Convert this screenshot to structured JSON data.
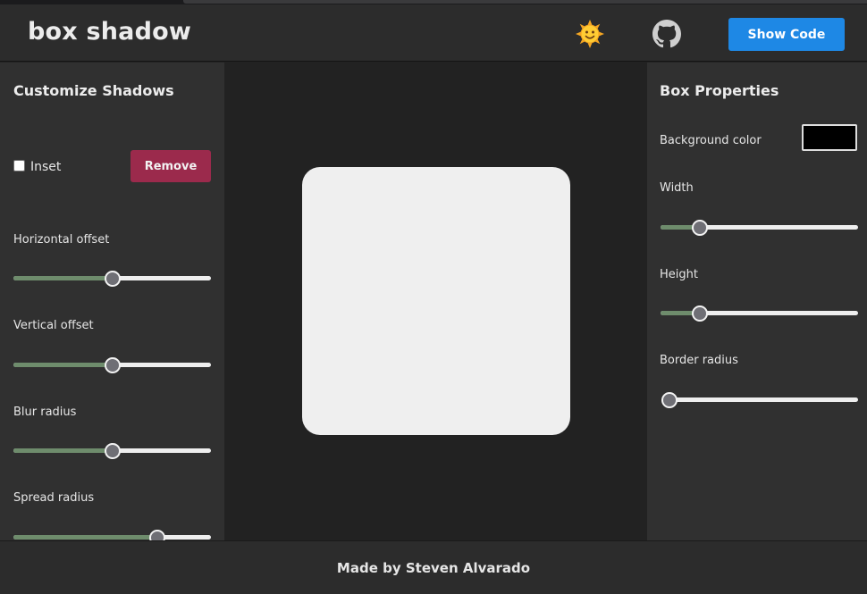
{
  "header": {
    "title": "box shadow",
    "theme_icon": "sun-face-icon",
    "github_icon": "github-icon",
    "show_code_label": "Show Code"
  },
  "colors": {
    "accent": "#1e88e5",
    "remove": "#9b2a4c",
    "slider_fill": "#6e8c6c",
    "box": "#efefef"
  },
  "shadow_panel": {
    "title": "Customize Shadows",
    "inset_label": "Inset",
    "inset_checked": false,
    "remove_label": "Remove",
    "sliders": [
      {
        "label": "Horizontal offset",
        "fraction": 0.5
      },
      {
        "label": "Vertical offset",
        "fraction": 0.5
      },
      {
        "label": "Blur radius",
        "fraction": 0.5
      },
      {
        "label": "Spread radius",
        "fraction": 0.73
      }
    ]
  },
  "box_panel": {
    "title": "Box Properties",
    "bg_label": "Background color",
    "bg_color": "#000000",
    "sliders": [
      {
        "label": "Width",
        "fraction": 0.2
      },
      {
        "label": "Height",
        "fraction": 0.2
      },
      {
        "label": "Border radius",
        "fraction": 0.0
      }
    ]
  },
  "footer": {
    "credit": "Made by Steven Alvarado"
  }
}
